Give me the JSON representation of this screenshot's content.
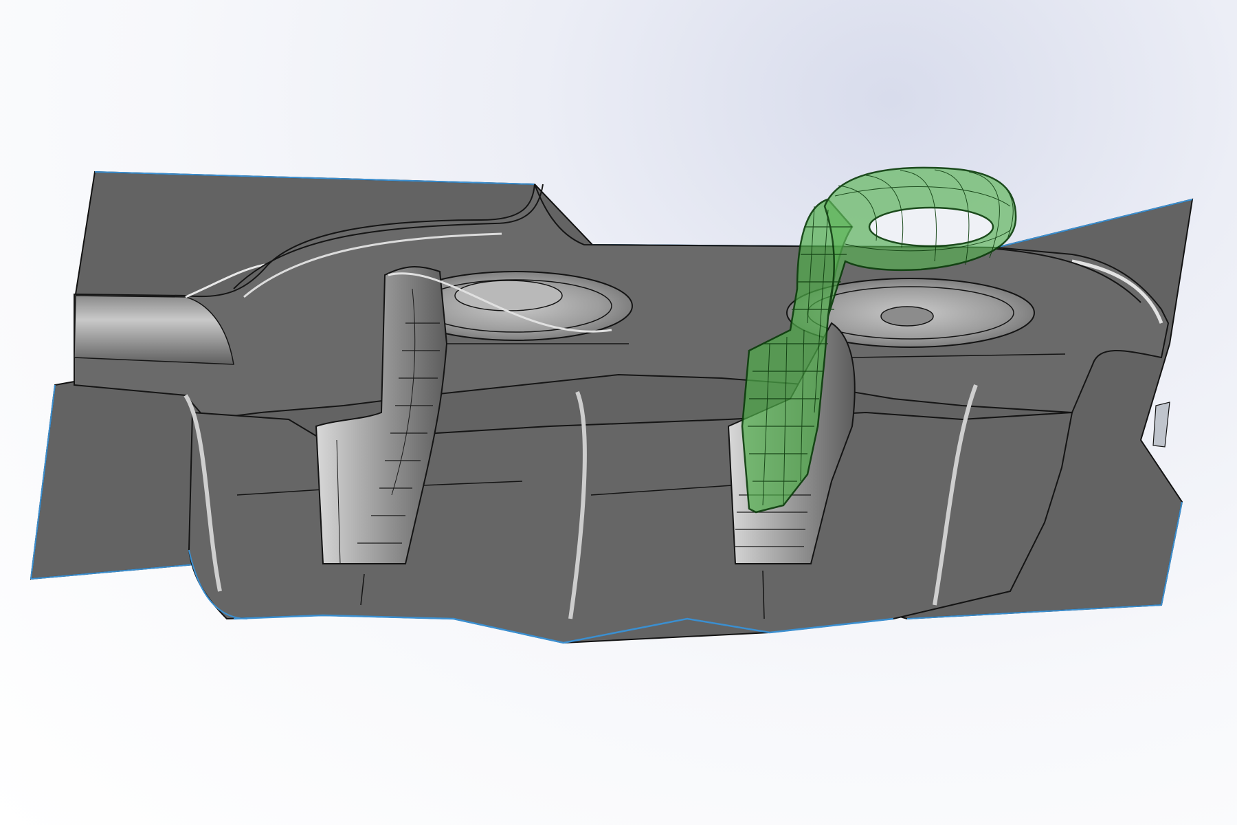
{
  "viewport": {
    "background_gradient": [
      "#dadde9",
      "#ffffff"
    ],
    "icon": "cad-3d-model-view"
  },
  "model": {
    "mold_block": {
      "face_color": "#636363",
      "edge_color": "#121212",
      "highlight_color": "#e4e4e4",
      "silhouette_color": "#3b8fd0"
    },
    "cavities": [
      {
        "name": "left-cavity",
        "state": "empty"
      },
      {
        "name": "right-cavity",
        "state": "filled"
      }
    ],
    "inserted_part": {
      "display_mode": "transparent-wireframe",
      "color": "#3ea43c",
      "edge_color": "#0c3f0c"
    }
  }
}
